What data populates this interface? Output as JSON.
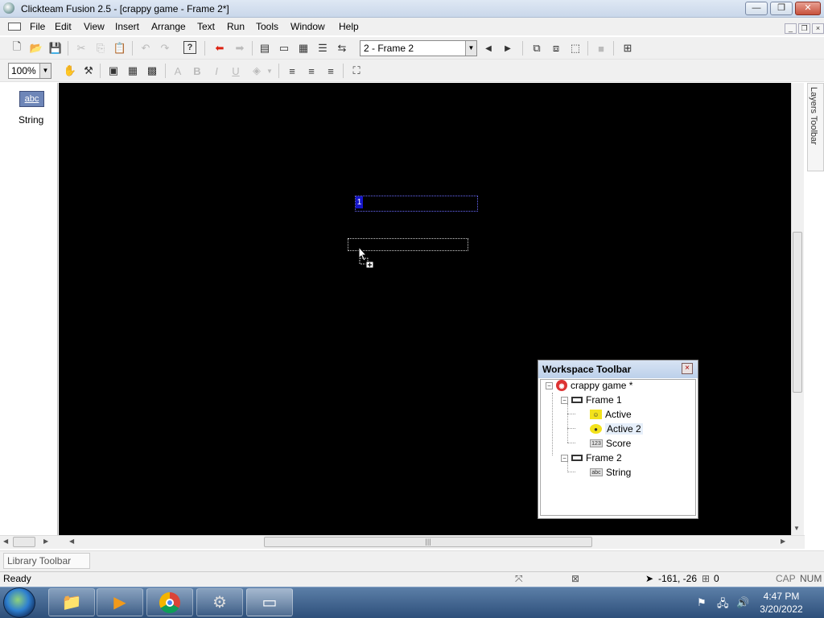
{
  "window": {
    "title": "Clickteam Fusion 2.5 - [crappy game - Frame 2*]",
    "min_label": "—",
    "max_label": "❐",
    "close_label": "✕"
  },
  "menu": {
    "items": [
      "File",
      "Edit",
      "View",
      "Insert",
      "Arrange",
      "Text",
      "Run",
      "Tools",
      "Window",
      "Help"
    ]
  },
  "toolbar": {
    "frame_select": "2 - Frame 2",
    "zoom": "100%",
    "prev_frame": "◀",
    "next_frame": "▶",
    "run_stop": "■"
  },
  "left_panel": {
    "string_icon_text": "abc",
    "string_label": "String"
  },
  "canvas": {
    "string_object_1_number": "1"
  },
  "right_panel": {
    "layers_tab": "Layers Toolbar"
  },
  "library_toolbar": {
    "tab_label": "Library Toolbar"
  },
  "statusbar": {
    "status": "Ready",
    "coords": "-161, -26",
    "count": "0",
    "cap": "CAP",
    "num": "NUM"
  },
  "workspace": {
    "title": "Workspace Toolbar",
    "app": "crappy game *",
    "frame1": "Frame 1",
    "frame1_objects": [
      "Active",
      "Active 2",
      "Score"
    ],
    "frame2": "Frame 2",
    "frame2_objects": [
      "String"
    ]
  },
  "taskbar": {
    "time": "4:47 PM",
    "date": "3/20/2022"
  }
}
